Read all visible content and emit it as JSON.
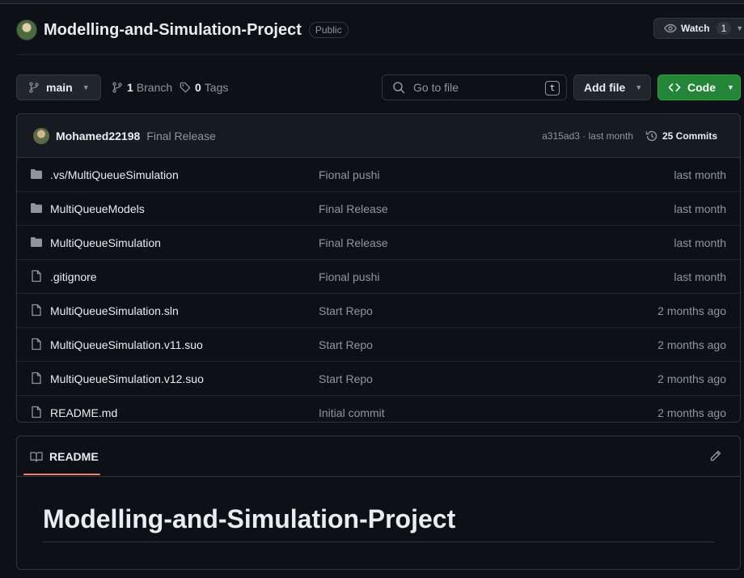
{
  "repo": {
    "name": "Modelling-and-Simulation-Project",
    "visibility": "Public",
    "watch_label": "Watch",
    "watch_count": "1"
  },
  "toolbar": {
    "branch": "main",
    "branch_count": "1",
    "branch_label": "Branch",
    "tag_count": "0",
    "tag_label": "Tags",
    "search_placeholder": "Go to file",
    "search_shortcut": "t",
    "add_file_label": "Add file",
    "code_label": "Code"
  },
  "latest_commit": {
    "author": "Mohamed22198",
    "message": "Final Release",
    "hash_time": "a315ad3 · last month",
    "commits_count": "25 Commits"
  },
  "files": [
    {
      "type": "folder",
      "name": ".vs/MultiQueueSimulation",
      "message": "Fional pushi",
      "date": "last month"
    },
    {
      "type": "folder",
      "name": "MultiQueueModels",
      "message": "Final Release",
      "date": "last month"
    },
    {
      "type": "folder",
      "name": "MultiQueueSimulation",
      "message": "Final Release",
      "date": "last month"
    },
    {
      "type": "file",
      "name": ".gitignore",
      "message": "Fional pushi",
      "date": "last month"
    },
    {
      "type": "file",
      "name": "MultiQueueSimulation.sln",
      "message": "Start Repo",
      "date": "2 months ago"
    },
    {
      "type": "file",
      "name": "MultiQueueSimulation.v11.suo",
      "message": "Start Repo",
      "date": "2 months ago"
    },
    {
      "type": "file",
      "name": "MultiQueueSimulation.v12.suo",
      "message": "Start Repo",
      "date": "2 months ago"
    },
    {
      "type": "file",
      "name": "README.md",
      "message": "Initial commit",
      "date": "2 months ago"
    }
  ],
  "readme": {
    "tab_label": "README",
    "heading": "Modelling-and-Simulation-Project"
  },
  "colors": {
    "accent_green": "#238636",
    "tab_underline": "#f78166",
    "muted_text": "#8d96a0"
  }
}
